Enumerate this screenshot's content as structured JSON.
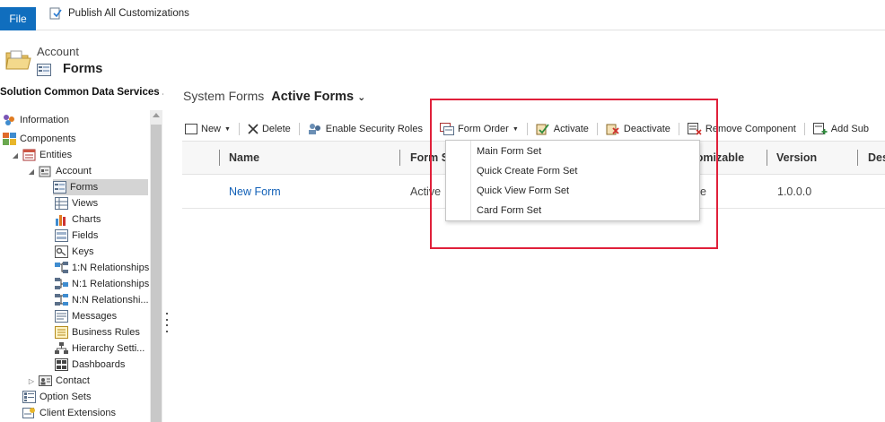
{
  "topbar": {
    "file_label": "File",
    "publish_label": "Publish All Customizations"
  },
  "header": {
    "entity": "Account",
    "page_title": "Forms"
  },
  "sidebar": {
    "title": "Solution Common Data Services ...",
    "items": [
      {
        "label": "Information",
        "icon": "information-icon"
      },
      {
        "label": "Components",
        "icon": "components-icon"
      },
      {
        "label": "Entities",
        "icon": "entities-icon"
      },
      {
        "label": "Account",
        "icon": "account-entity-icon"
      },
      {
        "label": "Forms",
        "icon": "forms-icon"
      },
      {
        "label": "Views",
        "icon": "views-icon"
      },
      {
        "label": "Charts",
        "icon": "charts-icon"
      },
      {
        "label": "Fields",
        "icon": "fields-icon"
      },
      {
        "label": "Keys",
        "icon": "keys-icon"
      },
      {
        "label": "1:N Relationships",
        "icon": "relationship-icon"
      },
      {
        "label": "N:1 Relationships",
        "icon": "relationship-icon"
      },
      {
        "label": "N:N Relationshi...",
        "icon": "relationship-icon"
      },
      {
        "label": "Messages",
        "icon": "messages-icon"
      },
      {
        "label": "Business Rules",
        "icon": "business-rules-icon"
      },
      {
        "label": "Hierarchy Setti...",
        "icon": "hierarchy-icon"
      },
      {
        "label": "Dashboards",
        "icon": "dashboards-icon"
      },
      {
        "label": "Contact",
        "icon": "contact-entity-icon"
      },
      {
        "label": "Option Sets",
        "icon": "option-sets-icon"
      },
      {
        "label": "Client Extensions",
        "icon": "client-extensions-icon"
      }
    ]
  },
  "view": {
    "prefix": "System Forms",
    "name": "Active Forms"
  },
  "commands": {
    "new": "New",
    "delete": "Delete",
    "enable_security_roles": "Enable Security Roles",
    "form_order": "Form Order",
    "activate": "Activate",
    "deactivate": "Deactivate",
    "remove_component": "Remove Component",
    "add_sub": "Add Sub"
  },
  "grid": {
    "columns": [
      "Name",
      "Form S",
      "ustomizable",
      "Version",
      "Des"
    ],
    "row": {
      "name": "New Form",
      "form_state": "Active",
      "customizable": "e",
      "version": "1.0.0.0"
    }
  },
  "dropdown": {
    "items": [
      "Main Form Set",
      "Quick Create Form Set",
      "Quick View Form Set",
      "Card Form Set"
    ]
  },
  "colors": {
    "file_button": "#106ebe",
    "highlight": "#e0203a",
    "link": "#1160b7"
  }
}
